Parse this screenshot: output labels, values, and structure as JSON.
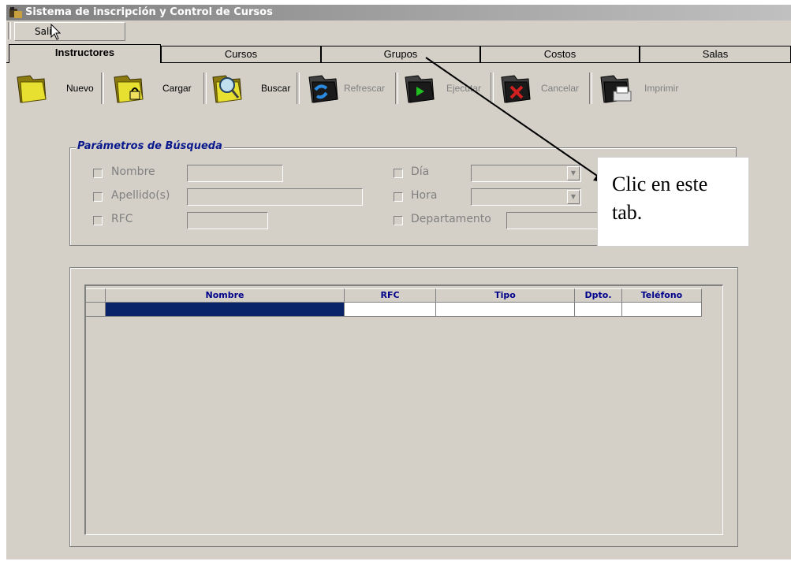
{
  "window": {
    "title": "Sistema de inscripción y Control de Cursos"
  },
  "menu": {
    "exit_label": "Salir"
  },
  "tabs": [
    {
      "label": "Instructores",
      "active": true
    },
    {
      "label": "Cursos",
      "active": false
    },
    {
      "label": "Grupos",
      "active": false
    },
    {
      "label": "Costos",
      "active": false
    },
    {
      "label": "Salas",
      "active": false
    }
  ],
  "toolbar": {
    "nuevo": {
      "label": "Nuevo",
      "icon": "folder-icon",
      "enabled": true
    },
    "cargar": {
      "label": "Cargar",
      "icon": "folder-lock-icon",
      "enabled": true
    },
    "buscar": {
      "label": "Buscar",
      "icon": "folder-search-icon",
      "enabled": true
    },
    "refrescar": {
      "label": "Refrescar",
      "icon": "folder-refresh-icon",
      "enabled": false
    },
    "ejecutar": {
      "label": "Ejecutar",
      "icon": "folder-run-icon",
      "enabled": false
    },
    "cancelar": {
      "label": "Cancelar",
      "icon": "folder-cancel-icon",
      "enabled": false
    },
    "imprimir": {
      "label": "Imprimir",
      "icon": "folder-print-icon",
      "enabled": false
    }
  },
  "search": {
    "legend": "Parámetros de Búsqueda",
    "nombre_label": "Nombre",
    "apellido_label": "Apellido(s)",
    "rfc_label": "RFC",
    "dia_label": "Día",
    "hora_label": "Hora",
    "departamento_label": "Departamento",
    "nombre_value": "",
    "apellido_value": "",
    "rfc_value": "",
    "dia_value": "",
    "hora_value": "",
    "departamento_value": ""
  },
  "table": {
    "columns": [
      "Nombre",
      "RFC",
      "Tipo",
      "Dpto.",
      "Teléfono"
    ],
    "rows": [
      [
        "",
        "",
        "",
        "",
        ""
      ]
    ]
  },
  "callout": {
    "text_line1": "Clic en este",
    "text_line2": "tab."
  },
  "colors": {
    "accent": "#0a246a",
    "legend": "#0a1a8c",
    "header_text": "#00008b",
    "face": "#d4d0c8"
  }
}
